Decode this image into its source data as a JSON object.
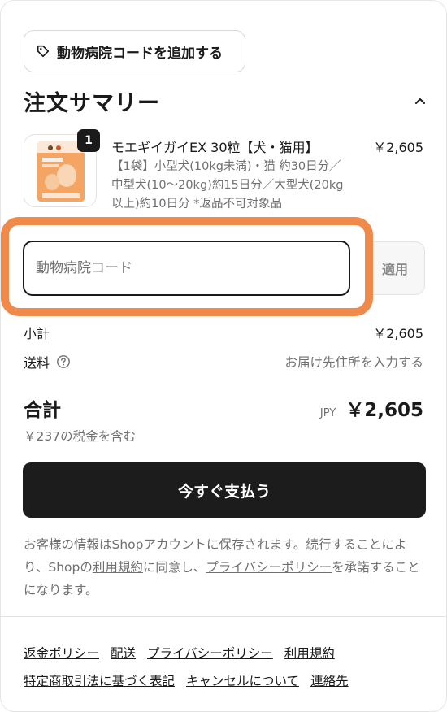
{
  "discount": {
    "add_code_label": "動物病院コードを追加する",
    "input_placeholder": "動物病院コード",
    "apply_label": "適用"
  },
  "summary": {
    "title": "注文サマリー"
  },
  "product": {
    "quantity": "1",
    "name": "モエギイガイEX 30粒【犬・猫用】",
    "price": "￥2,605",
    "description": "【1袋】小型犬(10kg未満)・猫 約30日分／中型犬(10〜20kg)約15日分／大型犬(20kg以上)約10日分 *返品不可対象品"
  },
  "totals": {
    "subtotal_label": "小計",
    "subtotal_value": "￥2,605",
    "shipping_label": "送料",
    "shipping_value": "お届け先住所を入力する",
    "total_label": "合計",
    "currency": "JPY",
    "total_value": "￥2,605",
    "tax_note": "￥237の税金を含む"
  },
  "pay_button_label": "今すぐ支払う",
  "consent": {
    "part1": "お客様の情報はShopアカウントに保存されます。続行することにより、Shopの",
    "terms_link": "利用規約",
    "part2": "に同意し、",
    "privacy_link": "プライバシーポリシー",
    "part3": "を承諾することになります。"
  },
  "footer": {
    "links": [
      "返金ポリシー",
      "配送",
      "プライバシーポリシー",
      "利用規約",
      "特定商取引法に基づく表記",
      "キャンセルについて",
      "連絡先"
    ]
  },
  "colors": {
    "highlight": "#f08a4b",
    "primary_button": "#1c1c1c"
  }
}
